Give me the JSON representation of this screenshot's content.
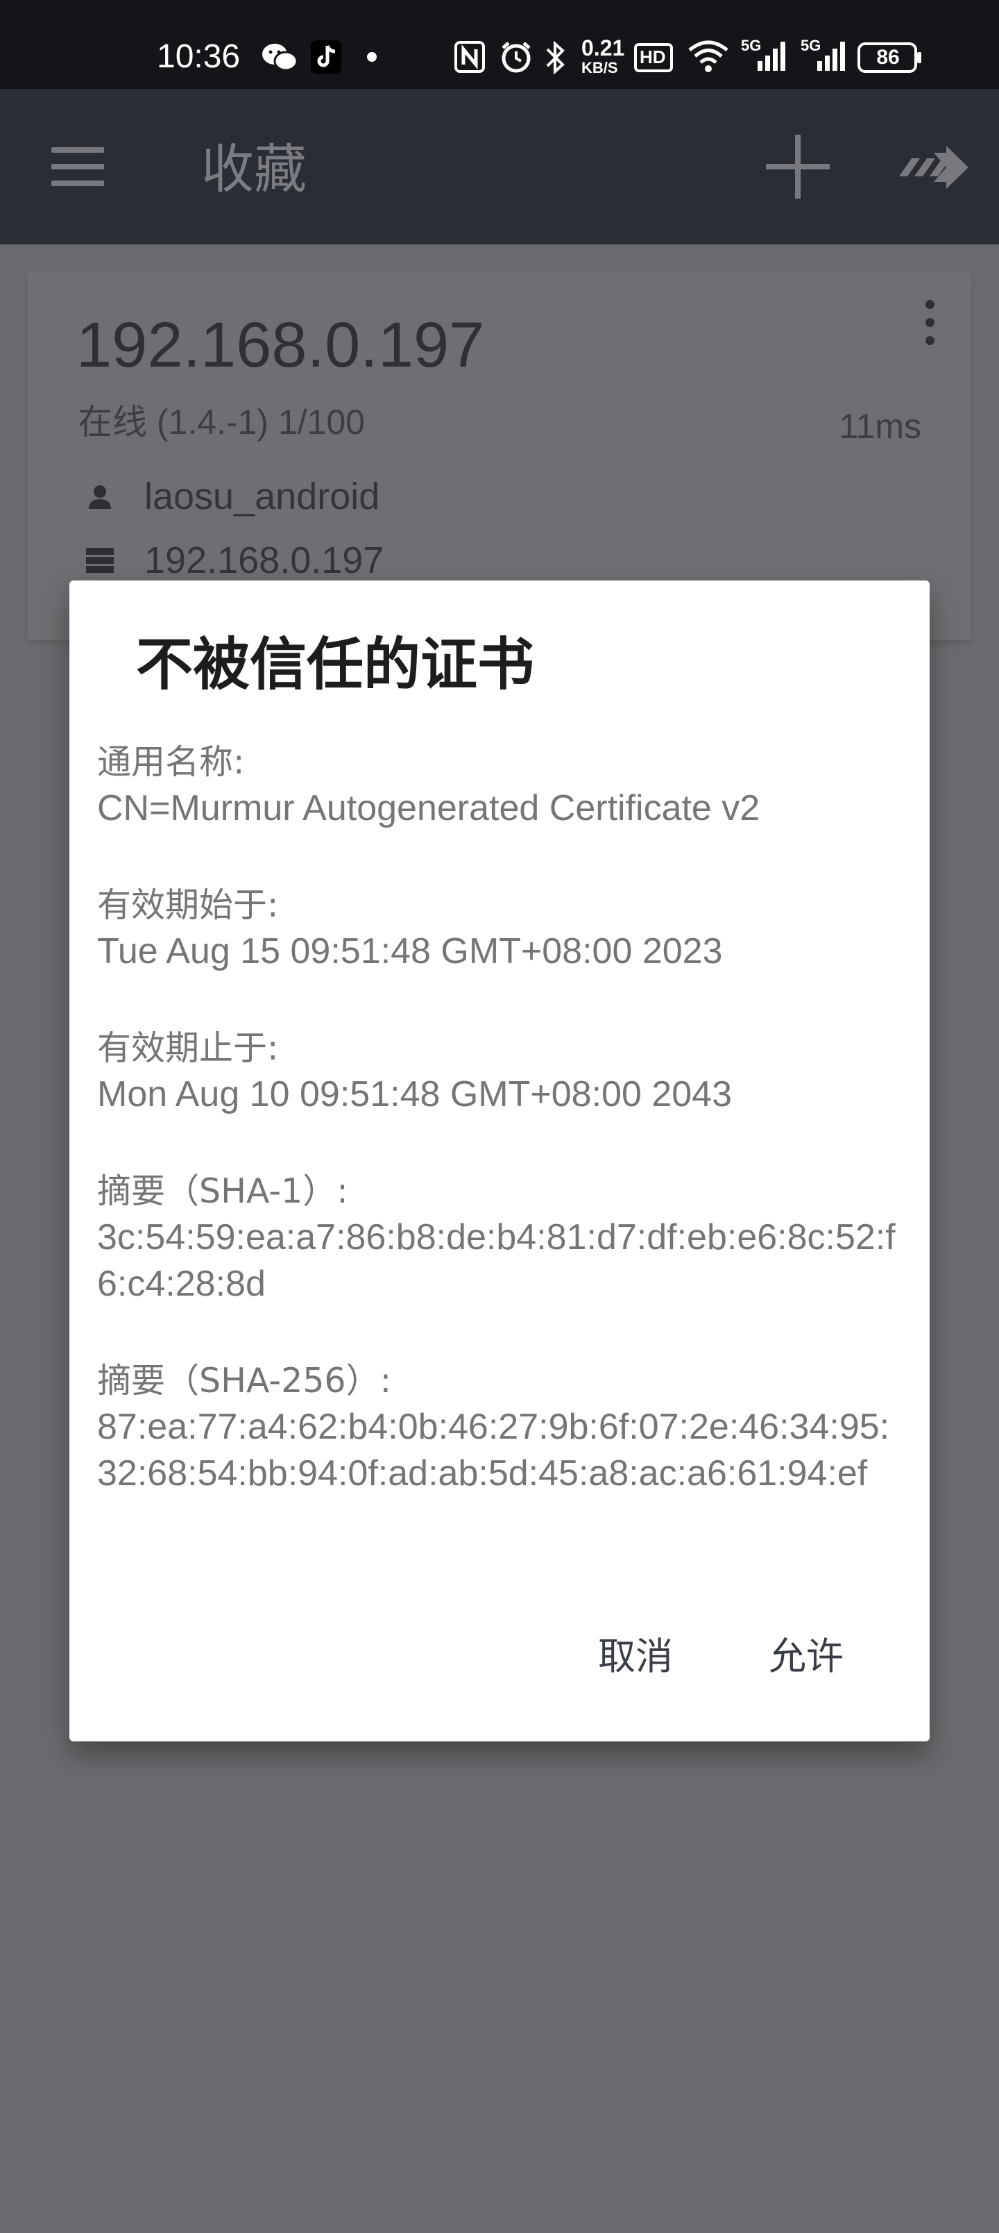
{
  "status_bar": {
    "time": "10:36",
    "net_speed_value": "0.21",
    "net_speed_unit": "KB/S",
    "hd_label": "HD",
    "signal1_label": "5G",
    "signal2_label": "5G",
    "battery": "86"
  },
  "app_bar": {
    "title": "收藏"
  },
  "server_card": {
    "host": "192.168.0.197",
    "status": "在线 (1.4.-1)  1/100",
    "latency": "11ms",
    "username": "laosu_android",
    "address": "192.168.0.197"
  },
  "dialog": {
    "title": "不被信任的证书",
    "fields": [
      {
        "label": "通用名称:",
        "value": "CN=Murmur Autogenerated Certificate v2"
      },
      {
        "label": "有效期始于:",
        "value": "Tue Aug 15 09:51:48 GMT+08:00 2023"
      },
      {
        "label": "有效期止于:",
        "value": "Mon Aug 10 09:51:48 GMT+08:00 2043"
      },
      {
        "label": "摘要（SHA-1）:",
        "value": "3c:54:59:ea:a7:86:b8:de:b4:81:d7:df:eb:e6:8c:52:f6:c4:28:8d"
      },
      {
        "label": "摘要（SHA-256）:",
        "value": "87:ea:77:a4:62:b4:0b:46:27:9b:6f:07:2e:46:34:95:32:68:54:bb:94:0f:ad:ab:5d:45:a8:ac:a6:61:94:ef"
      }
    ],
    "cancel_label": "取消",
    "allow_label": "允许"
  }
}
